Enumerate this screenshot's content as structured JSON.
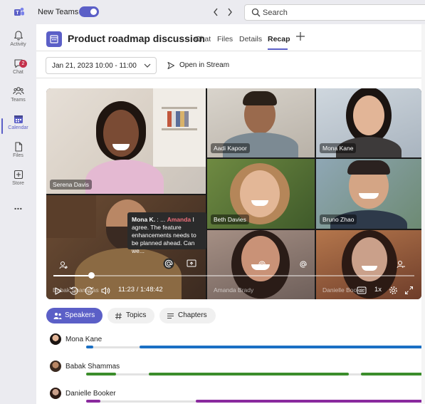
{
  "topbar": {
    "new_teams_label": "New Teams",
    "toggle_on": true,
    "back_icon": "chevron-left-icon",
    "forward_icon": "chevron-right-icon",
    "search_placeholder": "Search"
  },
  "rail": {
    "items": [
      {
        "label": "Activity",
        "icon": "bell-icon"
      },
      {
        "label": "Chat",
        "icon": "chat-icon",
        "badge": "2"
      },
      {
        "label": "Teams",
        "icon": "teams-icon"
      },
      {
        "label": "Calendar",
        "icon": "calendar-icon",
        "active": true
      },
      {
        "label": "Files",
        "icon": "file-icon"
      },
      {
        "label": "Store",
        "icon": "store-icon"
      }
    ],
    "more": "..."
  },
  "header": {
    "title": "Product roadmap discussion",
    "tabs": [
      "Chat",
      "Files",
      "Details",
      "Recap"
    ],
    "active_tab": "Recap"
  },
  "toolbar": {
    "date_range": "Jan 21, 2023 10:00 - 11:00",
    "open_in_stream": "Open in Stream"
  },
  "video": {
    "participants": [
      "Serena Davis",
      "Aadi Kapoor",
      "Mona Kane",
      "Beth Davies",
      "Bruno Zhao",
      "Amanda Brady",
      "Danielle Booker",
      "Babak Shammas"
    ],
    "tooltip": {
      "speaker": "Mona K.",
      "separator": " : ... ",
      "mention": "Amanda",
      "text": " I agree. The feature enhancements needs to be planned ahead. Can we..."
    },
    "time": "11:23 / 1:48:42",
    "progress": 0.104,
    "speed": "1x",
    "accent": "#5b5fc7"
  },
  "recap_tabs": [
    {
      "label": "Speakers",
      "active": true
    },
    {
      "label": "Topics"
    },
    {
      "label": "Chapters"
    }
  ],
  "speakers": [
    {
      "name": "Mona Kane",
      "color": "#1a6fc4"
    },
    {
      "name": "Babak Shammas",
      "color": "#3b8d2b"
    },
    {
      "name": "Danielle Booker",
      "color": "#8a2a9e"
    }
  ]
}
